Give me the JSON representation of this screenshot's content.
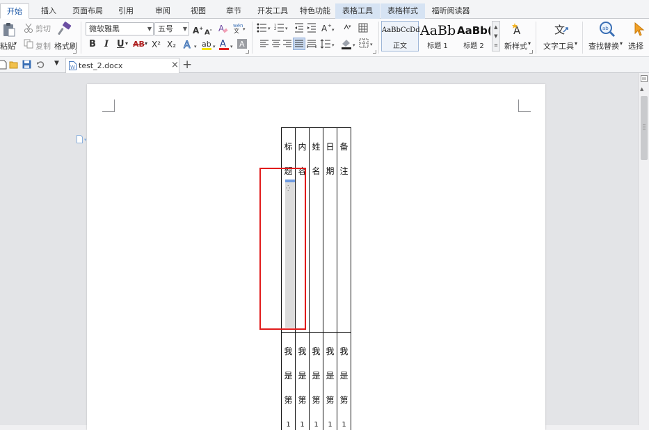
{
  "menu_tabs": [
    {
      "label": "开始",
      "active": true
    },
    {
      "label": "插入"
    },
    {
      "label": "页面布局"
    },
    {
      "label": "引用"
    },
    {
      "label": "审阅"
    },
    {
      "label": "视图"
    },
    {
      "label": "章节"
    },
    {
      "label": "开发工具"
    },
    {
      "label": "特色功能"
    },
    {
      "label": "表格工具",
      "contextual": true
    },
    {
      "label": "表格样式",
      "contextual": true
    },
    {
      "label": "福昕阅读器"
    }
  ],
  "ribbon": {
    "clipboard": {
      "paste": "粘贴",
      "cut": "剪切",
      "copy": "复制",
      "format_painter": "格式刷"
    },
    "font": {
      "name": "微软雅黑",
      "size": "五号",
      "bold": "B",
      "italic": "I",
      "underline": "U",
      "strike": "AB",
      "superscript": "X²",
      "subscript": "X₂"
    },
    "styles": {
      "items": [
        {
          "sample": "AaBbCcDd",
          "name": "正文"
        },
        {
          "sample": "AaBb",
          "name": "标题 1"
        },
        {
          "sample": "AaBb(",
          "name": "标题 2"
        }
      ],
      "new_style": "新样式"
    },
    "text_tools": "文字工具",
    "find_replace": "查找替换",
    "select": "选择"
  },
  "doc_tab": {
    "filename": "test_2.docx"
  },
  "table": {
    "header": [
      "标题",
      "内容",
      "姓名",
      "日期",
      "备注"
    ],
    "row1": [
      "我是第1",
      "我是第1",
      "我是第1",
      "我是第1",
      "我是第1"
    ]
  },
  "colors": {
    "accent": "#1f5aa8",
    "selection": "#e11b1b",
    "context_tab": "#d6e3f3"
  }
}
